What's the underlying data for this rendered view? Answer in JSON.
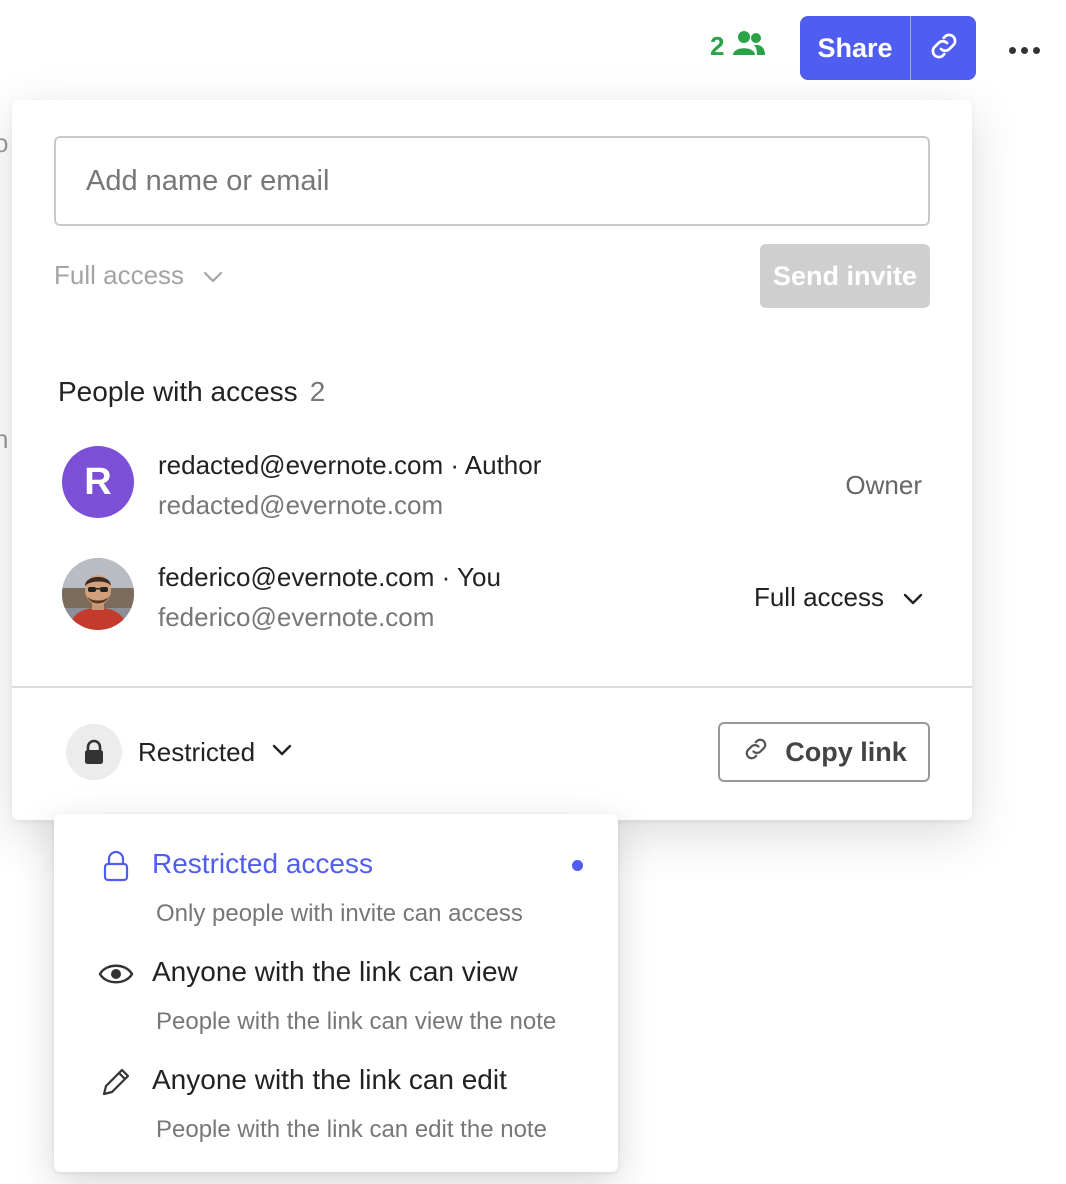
{
  "background": {
    "fragment_top": "o",
    "fragment_mid": "n"
  },
  "topbar": {
    "collaborator_count": "2",
    "collaborator_icon": "people-icon",
    "share_label": "Share",
    "share_link_icon": "link-icon",
    "more_icon": "ellipsis-icon",
    "accent_color": "#4f5ef0",
    "collab_color": "#2aa348"
  },
  "invite": {
    "placeholder": "Add name or email",
    "value": "",
    "access_level": "Full access",
    "send_label": "Send invite"
  },
  "people": {
    "heading": "People with access",
    "count": "2",
    "list": [
      {
        "initial": "R",
        "name": "redacted@evernote.com · Author",
        "email": "redacted@evernote.com",
        "role": "Owner",
        "avatar_color": "#7b4fd6"
      },
      {
        "name": "federico@evernote.com · You",
        "email": "federico@evernote.com",
        "role": "Full access"
      }
    ]
  },
  "footer": {
    "link_access": "Restricted",
    "copy_label": "Copy link"
  },
  "link_menu": {
    "options": [
      {
        "title": "Restricted access",
        "description": "Only people with invite can access",
        "icon": "lock-icon",
        "selected": true
      },
      {
        "title": "Anyone with the link can view",
        "description": "People with the link can view the note",
        "icon": "eye-icon",
        "selected": false
      },
      {
        "title": "Anyone with the link can edit",
        "description": "People with the link can edit the note",
        "icon": "pencil-icon",
        "selected": false
      }
    ]
  }
}
